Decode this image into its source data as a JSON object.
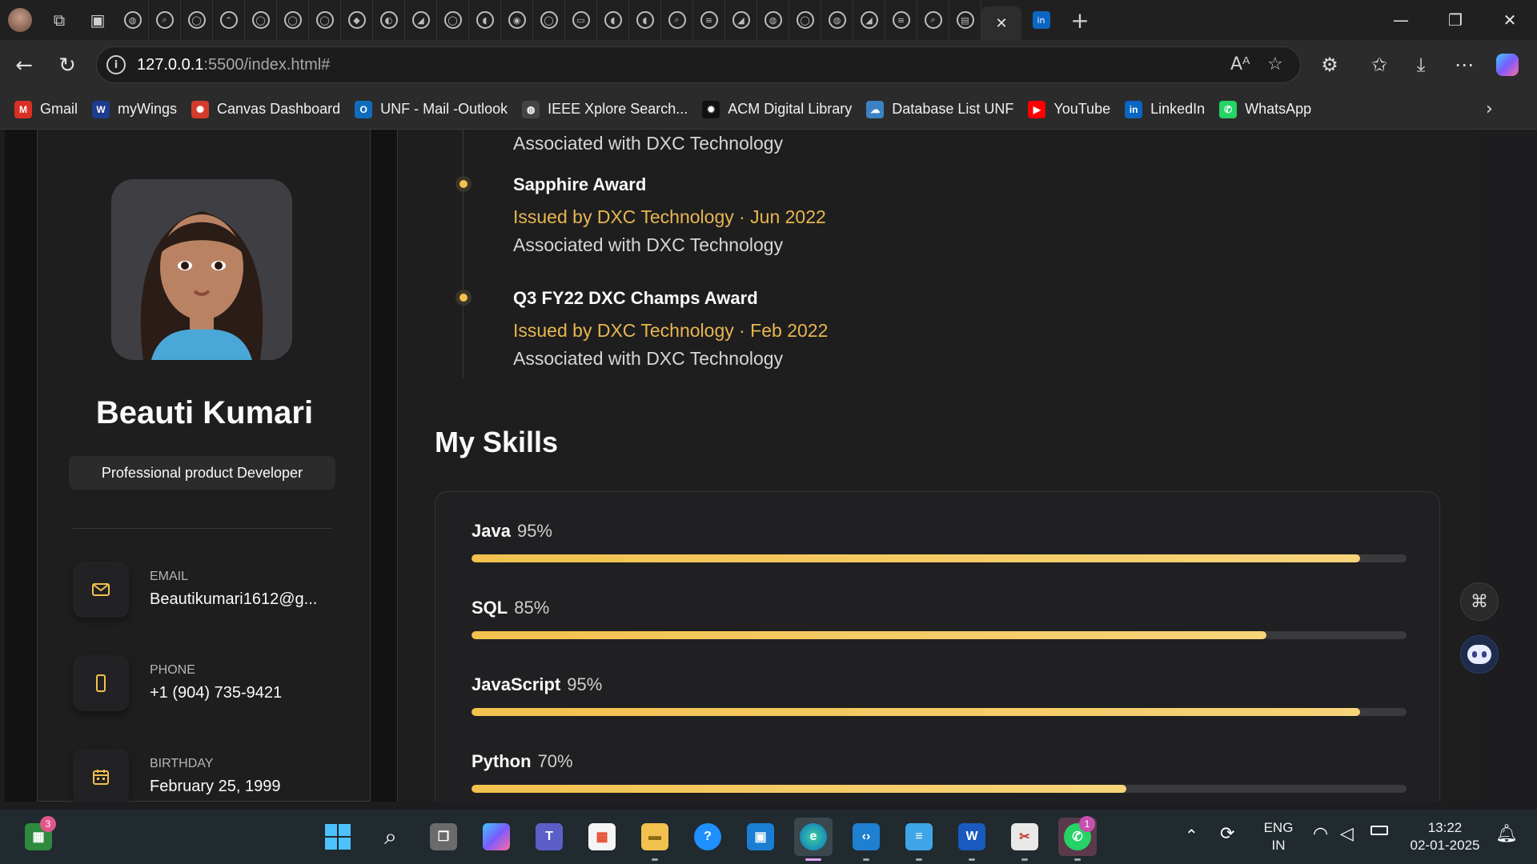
{
  "browser": {
    "tab_close_glyph": "✕",
    "new_tab_glyph": "+",
    "window": {
      "minimize": "—",
      "restore": "❐",
      "close": "✕"
    },
    "url": {
      "host": "127.0.0.1",
      "path": ":5500/index.html#"
    },
    "bookmarks": [
      {
        "label": "Gmail",
        "icon": "gmail-icon",
        "color": "#d93025",
        "glyph": "M"
      },
      {
        "label": "myWings",
        "icon": "mywings-icon",
        "color": "#1d3c8f",
        "glyph": "W"
      },
      {
        "label": "Canvas Dashboard",
        "icon": "canvas-icon",
        "color": "#d33b2c",
        "glyph": "✺"
      },
      {
        "label": "UNF - Mail -Outlook",
        "icon": "outlook-icon",
        "color": "#0f6cbd",
        "glyph": "O"
      },
      {
        "label": "IEEE Xplore Search...",
        "icon": "globe-icon",
        "color": "#444444",
        "glyph": "◍"
      },
      {
        "label": "ACM Digital Library",
        "icon": "acm-icon",
        "color": "#111111",
        "glyph": "✹"
      },
      {
        "label": "Database List UNF",
        "icon": "cloud-icon",
        "color": "#3b82c4",
        "glyph": "☁"
      },
      {
        "label": "YouTube",
        "icon": "youtube-icon",
        "color": "#ff0000",
        "glyph": "▶"
      },
      {
        "label": "LinkedIn",
        "icon": "linkedin-icon",
        "color": "#0a66c2",
        "glyph": "in"
      },
      {
        "label": "WhatsApp",
        "icon": "whatsapp-icon",
        "color": "#25d366",
        "glyph": "✆"
      }
    ]
  },
  "profile": {
    "name": "Beauti Kumari",
    "role": "Professional product Developer",
    "contacts": [
      {
        "label": "EMAIL",
        "value": "Beautikumari1612@g...",
        "icon": "mail-icon"
      },
      {
        "label": "PHONE",
        "value": "+1 (904) 735-9421",
        "icon": "phone-icon"
      },
      {
        "label": "BIRTHDAY",
        "value": "February 25, 1999",
        "icon": "calendar-icon"
      }
    ]
  },
  "awards": {
    "partial_assoc": "Associated with DXC Technology",
    "items": [
      {
        "title": "Sapphire Award",
        "issued": "Issued by DXC Technology · Jun 2022",
        "assoc": "Associated with DXC Technology"
      },
      {
        "title": "Q3 FY22 DXC Champs Award",
        "issued": "Issued by DXC Technology · Feb 2022",
        "assoc": "Associated with DXC Technology"
      }
    ]
  },
  "skills": {
    "title": "My Skills",
    "items": [
      {
        "name": "Java",
        "percent_label": "95%",
        "percent": 95
      },
      {
        "name": "SQL",
        "percent_label": "85%",
        "percent": 85
      },
      {
        "name": "JavaScript",
        "percent_label": "95%",
        "percent": 95
      },
      {
        "name": "Python",
        "percent_label": "70%",
        "percent": 70
      }
    ]
  },
  "taskbar": {
    "widgets_badge": "3",
    "whatsapp_badge": "1",
    "lang_line1": "ENG",
    "lang_line2": "IN",
    "time": "13:22",
    "date": "02-01-2025"
  },
  "colors": {
    "accent": "#f2c14e",
    "accent_text": "#e8b650",
    "page_bg": "#121212",
    "card_bg": "#1e1e1f"
  }
}
